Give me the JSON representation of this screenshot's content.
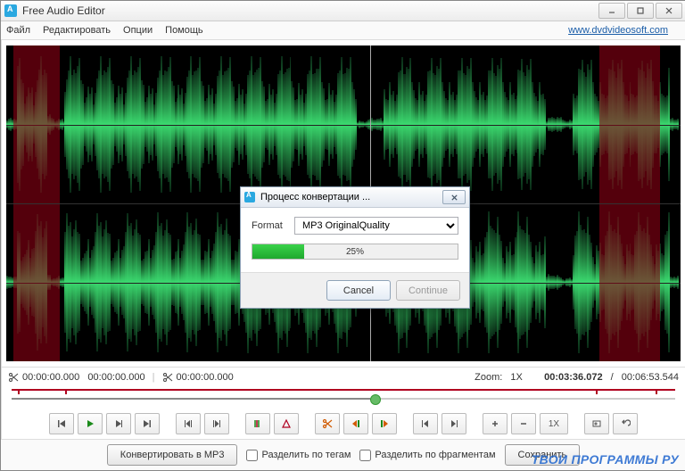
{
  "title": "Free Audio Editor",
  "menu": [
    "Файл",
    "Редактировать",
    "Опции",
    "Помощь"
  ],
  "site_link": "www.dvdvideosoft.com",
  "timebar": {
    "sel_start": "00:00:00.000",
    "sel_end": "00:00:00.000",
    "cut_pos": "00:00:00.000",
    "zoom_label": "Zoom:",
    "zoom_value": "1X",
    "position": "00:03:36.072",
    "duration": "00:06:53.544"
  },
  "toolbar_speed": "1X",
  "bottom": {
    "convert": "Конвертировать в MP3",
    "split_tags": "Разделить по тегам",
    "split_fragments": "Разделить по фрагментам",
    "save": "Сохранить"
  },
  "dialog": {
    "title": "Процесс конвертации ...",
    "format_label": "Format",
    "format_value": "MP3 OriginalQuality",
    "progress_pct": 25,
    "progress_label": "25%",
    "cancel": "Cancel",
    "continue": "Continue"
  },
  "watermark": "ТВОИ ПРОГРАММЫ РУ",
  "selections_pct": [
    [
      1,
      8
    ],
    [
      88,
      97
    ]
  ],
  "playhead_pct": 54
}
